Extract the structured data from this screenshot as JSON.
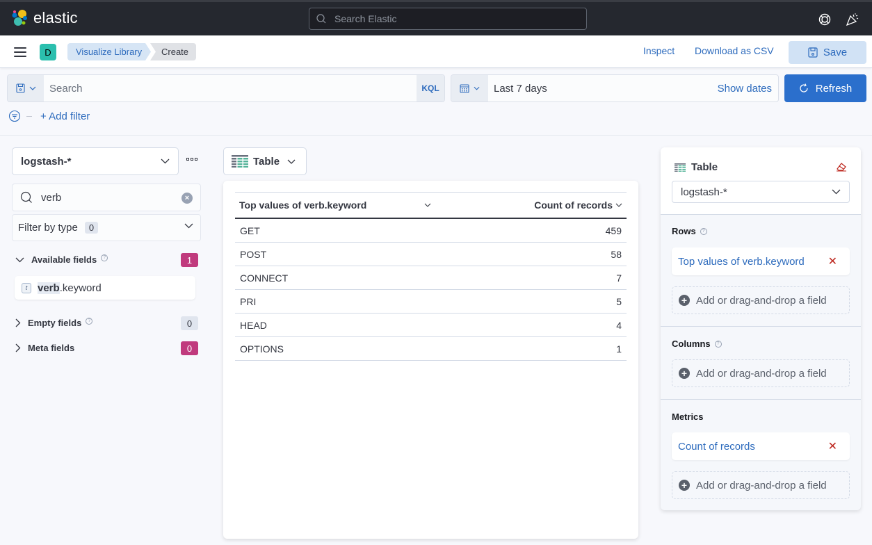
{
  "header": {
    "brand": "elastic",
    "search_placeholder": "Search Elastic",
    "icons": [
      "help-lifebuoy-icon",
      "newsfeed-party-icon"
    ]
  },
  "subheader": {
    "space_initial": "D",
    "breadcrumbs": [
      "Visualize Library",
      "Create"
    ],
    "inspect_label": "Inspect",
    "download_label": "Download as CSV",
    "save_label": "Save"
  },
  "query": {
    "placeholder": "Search",
    "language": "KQL",
    "date_range": "Last 7 days",
    "show_dates_label": "Show dates",
    "refresh_label": "Refresh",
    "add_filter_label": "+ Add filter"
  },
  "left_panel": {
    "index_pattern": "logstash-*",
    "field_search_value": "verb",
    "filter_by_type_label": "Filter by type",
    "filter_by_type_count": "0",
    "available_fields": {
      "label": "Available fields",
      "count": "1"
    },
    "fields": [
      {
        "type": "t",
        "highlight": "verb",
        "rest": ".keyword"
      }
    ],
    "empty_fields": {
      "label": "Empty fields",
      "count": "0"
    },
    "meta_fields": {
      "label": "Meta fields",
      "count": "0"
    }
  },
  "workspace": {
    "vis_type": "Table",
    "table": {
      "columns": [
        "Top values of verb.keyword",
        "Count of records"
      ],
      "rows": [
        [
          "GET",
          "459"
        ],
        [
          "POST",
          "58"
        ],
        [
          "CONNECT",
          "7"
        ],
        [
          "PRI",
          "5"
        ],
        [
          "HEAD",
          "4"
        ],
        [
          "OPTIONS",
          "1"
        ]
      ]
    }
  },
  "config_panel": {
    "title": "Table",
    "index_pattern": "logstash-*",
    "rows_label": "Rows",
    "rows_dimension": "Top values of verb.keyword",
    "columns_label": "Columns",
    "metrics_label": "Metrics",
    "metrics_dimension": "Count of records",
    "add_field_label": "Add or drag-and-drop a field"
  },
  "colors": {
    "accent": "#2b6fcc",
    "link": "#2d6bbd",
    "header_bg": "#25282f",
    "badge_pink": "#c03a7d",
    "danger": "#bd271e"
  }
}
